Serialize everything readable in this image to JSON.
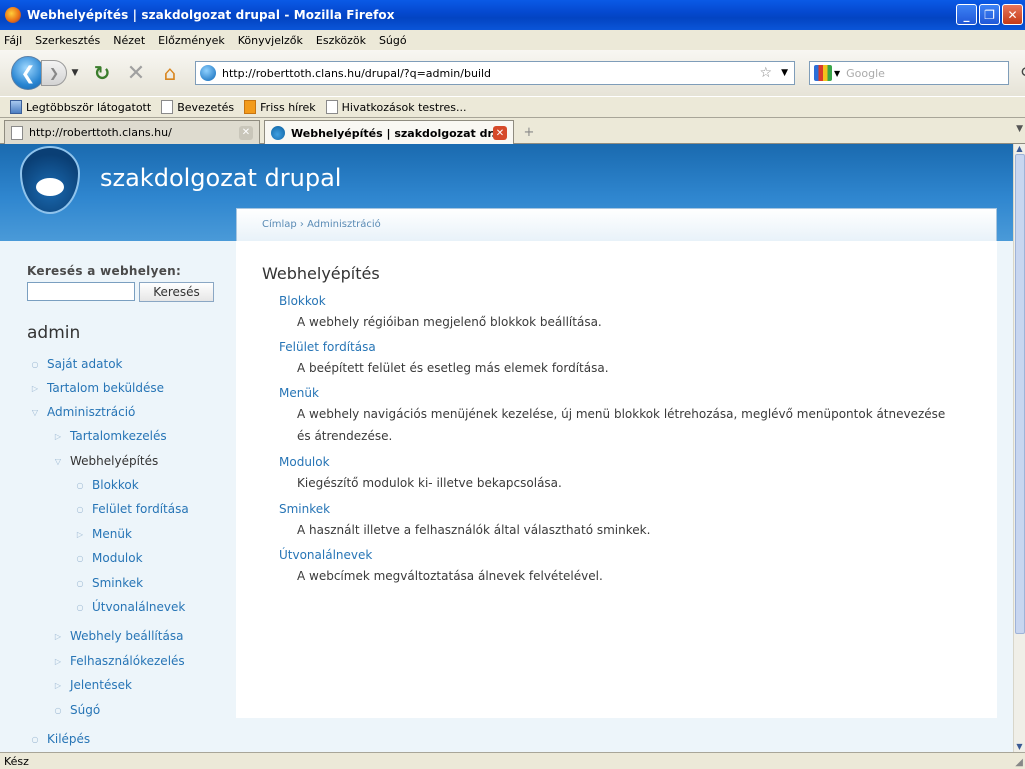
{
  "window": {
    "title": "Webhelyépítés | szakdolgozat drupal - Mozilla Firefox",
    "minimize_glyph": "_",
    "maximize_glyph": "❐",
    "close_glyph": "✕"
  },
  "menubar": [
    "Fájl",
    "Szerkesztés",
    "Nézet",
    "Előzmények",
    "Könyvjelzők",
    "Eszközök",
    "Súgó"
  ],
  "navbar": {
    "url": "http://roberttoth.clans.hu/drupal/?q=admin/build",
    "search_placeholder": "Google",
    "icons": [
      "back-icon",
      "forward-icon",
      "reload-icon",
      "stop-icon",
      "home-icon",
      "bookmark-star-icon",
      "search-icon"
    ]
  },
  "bookmarks": [
    "Legtöbbször látogatott",
    "Bevezetés",
    "Friss hírek",
    "Hivatkozások testres..."
  ],
  "tabs": [
    {
      "label": "http://roberttoth.clans.hu/",
      "active": false
    },
    {
      "label": "Webhelyépítés | szakdolgozat dr...",
      "active": true
    }
  ],
  "site": {
    "name": "szakdolgozat drupal",
    "breadcrumb": "Címlap › Adminisztráció"
  },
  "sidebar": {
    "search_label": "Keresés a webhelyen:",
    "search_button": "Keresés",
    "user_block_title": "admin",
    "menu": [
      {
        "label": "Saját adatok",
        "bullet": "○"
      },
      {
        "label": "Tartalom beküldése",
        "bullet": "▷"
      },
      {
        "label": "Adminisztráció",
        "bullet": "▽"
      },
      {
        "label": "Tartalomkezelés",
        "bullet": "▷"
      },
      {
        "label": "Webhelyépítés",
        "bullet": "▽"
      },
      {
        "label": "Blokkok",
        "bullet": "○"
      },
      {
        "label": "Felület fordítása",
        "bullet": "○"
      },
      {
        "label": "Menük",
        "bullet": "▷"
      },
      {
        "label": "Modulok",
        "bullet": "○"
      },
      {
        "label": "Sminkek",
        "bullet": "○"
      },
      {
        "label": "Útvonalálnevek",
        "bullet": "○"
      },
      {
        "label": "Webhely beállítása",
        "bullet": "▷"
      },
      {
        "label": "Felhasználókezelés",
        "bullet": "▷"
      },
      {
        "label": "Jelentések",
        "bullet": "▷"
      },
      {
        "label": "Súgó",
        "bullet": "○"
      },
      {
        "label": "Kilépés",
        "bullet": "○"
      }
    ]
  },
  "content": {
    "title": "Webhelyépítés",
    "items": [
      {
        "link": "Blokkok",
        "desc": "A webhely régióiban megjelenő blokkok beállítása."
      },
      {
        "link": "Felület fordítása",
        "desc": "A beépített felület és esetleg más elemek fordítása."
      },
      {
        "link": "Menük",
        "desc": "A webhely navigációs menüjének kezelése, új menü blokkok létrehozása, meglévő menüpontok átnevezése és átrendezése."
      },
      {
        "link": "Modulok",
        "desc": "Kiegészítő modulok ki- illetve bekapcsolása."
      },
      {
        "link": "Sminkek",
        "desc": "A használt illetve a felhasználók által választható sminkek."
      },
      {
        "link": "Útvonalálnevek",
        "desc": "A webcímek megváltoztatása álnevek felvételével."
      }
    ]
  },
  "statusbar": {
    "text": "Kész"
  },
  "colors": {
    "link": "#2775b6",
    "header_top": "#1a6aaf",
    "header_bottom": "#4a9ad8",
    "xp_title": "#0a5ae6"
  }
}
